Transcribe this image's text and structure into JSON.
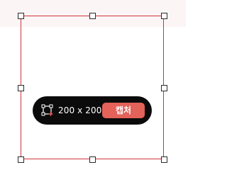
{
  "toolbar": {
    "size_text": "200 x 200",
    "capture_label": "캡처",
    "crop_icon": "crop-icon"
  },
  "colors": {
    "selection_border": "#d0343c",
    "toolbar_background": "#0b0b0b",
    "capture_button": "#e3625a",
    "top_band": "#fcf5f6"
  }
}
